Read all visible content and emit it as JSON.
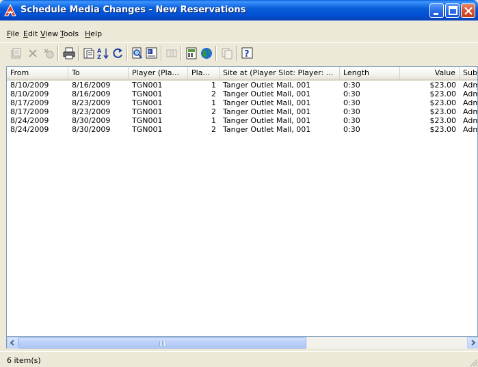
{
  "window": {
    "title": "Schedule Media Changes - New Reservations",
    "accent_color": "#0A5FD9",
    "close_color": "#D9542B"
  },
  "menu": {
    "items": [
      {
        "key": "F",
        "rest": "ile"
      },
      {
        "key": "E",
        "rest": "dit"
      },
      {
        "key": "V",
        "rest": "iew"
      },
      {
        "key": "T",
        "rest": "ools"
      },
      {
        "key": "H",
        "rest": "elp"
      }
    ]
  },
  "toolbar": {
    "icons": [
      "properties-icon",
      "delete-icon",
      "new-icon",
      "print-icon",
      "print-preview-icon",
      "sort-icon",
      "refresh-icon",
      "find-icon",
      "export-icon",
      "columns-icon",
      "calculator-icon",
      "globe-icon",
      "copy-icon",
      "help-icon"
    ]
  },
  "table": {
    "columns": [
      "From",
      "To",
      "Player (Pla...",
      "Pla...",
      "Site at (Player Slot: Player: ...",
      "Length",
      "Value",
      "Subs"
    ],
    "rows": [
      [
        "8/10/2009",
        "8/16/2009",
        "TGN001",
        "1",
        "Tanger Outlet Mall, 001",
        "0:30",
        "$23.00",
        "Adm"
      ],
      [
        "8/10/2009",
        "8/16/2009",
        "TGN001",
        "2",
        "Tanger Outlet Mall, 001",
        "0:30",
        "$23.00",
        "Adm"
      ],
      [
        "8/17/2009",
        "8/23/2009",
        "TGN001",
        "1",
        "Tanger Outlet Mall, 001",
        "0:30",
        "$23.00",
        "Adm"
      ],
      [
        "8/17/2009",
        "8/23/2009",
        "TGN001",
        "2",
        "Tanger Outlet Mall, 001",
        "0:30",
        "$23.00",
        "Adm"
      ],
      [
        "8/24/2009",
        "8/30/2009",
        "TGN001",
        "1",
        "Tanger Outlet Mall, 001",
        "0:30",
        "$23.00",
        "Adm"
      ],
      [
        "8/24/2009",
        "8/30/2009",
        "TGN001",
        "2",
        "Tanger Outlet Mall, 001",
        "0:30",
        "$23.00",
        "Adm"
      ]
    ]
  },
  "status": {
    "text": "6 item(s)"
  }
}
